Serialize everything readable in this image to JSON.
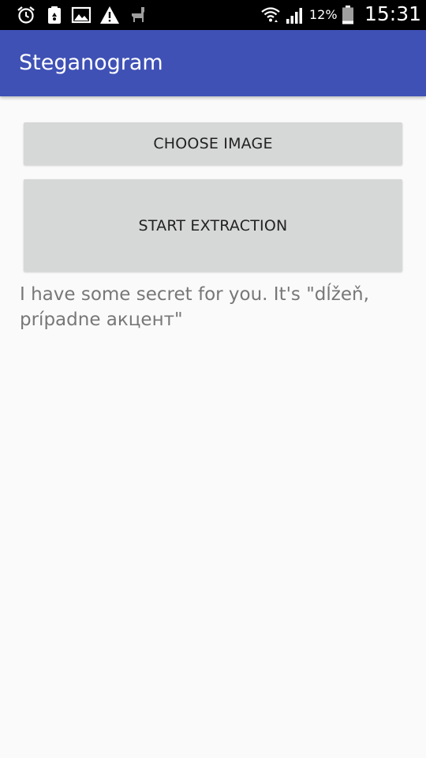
{
  "status_bar": {
    "battery_percent": "12%",
    "time": "15:31",
    "icons": [
      "alarm-icon",
      "recycle-icon",
      "image-icon",
      "warning-icon",
      "llama-icon",
      "wifi-icon",
      "signal-icon",
      "battery-icon"
    ]
  },
  "app_bar": {
    "title": "Steganogram"
  },
  "buttons": {
    "choose_image": "CHOOSE IMAGE",
    "start_extraction": "START EXTRACTION"
  },
  "result": {
    "text": "I have some secret for you. It's \"dĺžeň, prípadne акцент\""
  },
  "colors": {
    "primary": "#3f51b5",
    "status_bar": "#000000",
    "background": "#fafafa",
    "button": "#d6d7d7",
    "result_text": "#777777"
  }
}
